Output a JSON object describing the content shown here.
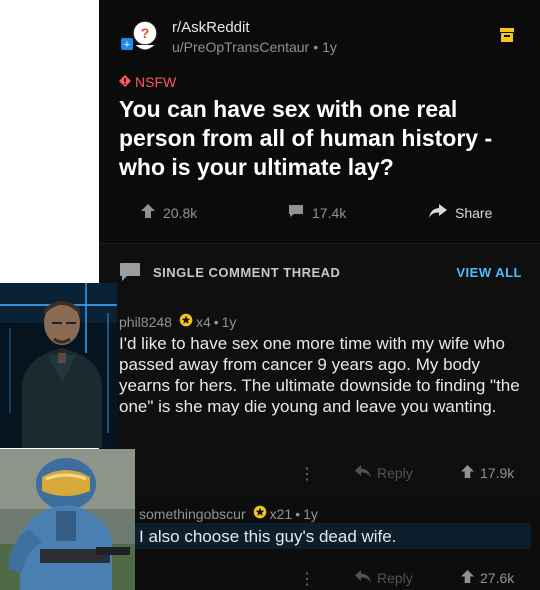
{
  "post": {
    "subreddit": "r/AskReddit",
    "author": "u/PreOpTransCentaur",
    "age": "1y",
    "nsfw_label": "NSFW",
    "title": "You can have sex with one real person from all of human history - who is your ultimate lay?",
    "upvotes": "20.8k",
    "comments": "17.4k",
    "share_label": "Share"
  },
  "thread": {
    "label": "SINGLE COMMENT THREAD",
    "view_all": "VIEW ALL"
  },
  "comments": [
    {
      "author": "phil8248",
      "award_count": "x4",
      "age": "1y",
      "body": "I'd like to have sex one more time with my wife who passed away from cancer 9 years ago. My body yearns for hers. The ultimate downside to finding \"the one\" is she may die young and leave you wanting.",
      "reply_label": "Reply",
      "votes": "17.9k"
    },
    {
      "author": "somethingobscur",
      "award_count": "x21",
      "age": "1y",
      "body": "I also choose this guy's dead wife.",
      "reply_label": "Reply",
      "votes": "27.6k"
    }
  ],
  "colors": {
    "background": "#0d0d0e",
    "nsfw": "#ff585b",
    "link": "#4fbcff",
    "archive": "#f5c518",
    "award": "#f5c518"
  },
  "icons": [
    "avatar-icon",
    "archive-icon",
    "nsfw-diamond-icon",
    "upvote-icon",
    "comment-icon",
    "share-icon",
    "chat-bubble-icon",
    "award-icon",
    "kebab-icon",
    "reply-icon"
  ]
}
